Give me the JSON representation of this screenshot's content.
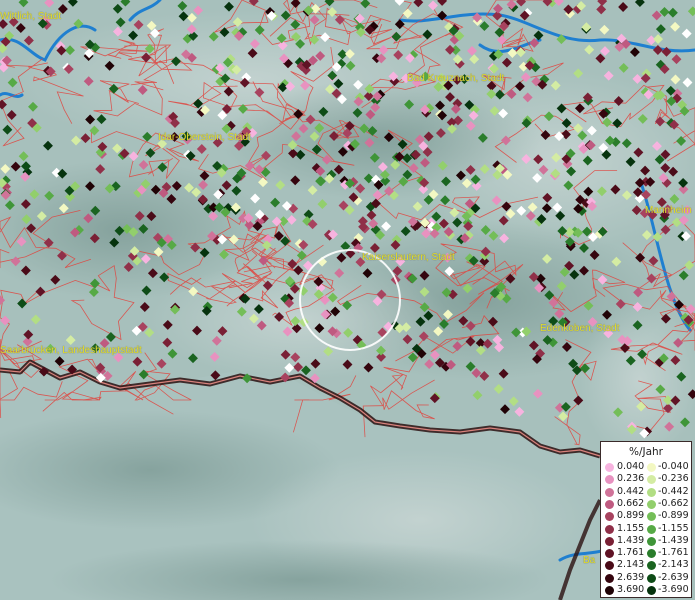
{
  "map": {
    "cities": [
      "Wittlich, Stadt",
      "Bad Kreuznach, Stadt",
      "Idar-Oberstein, Stadt",
      "Kaiserslautern, Stadt",
      "Mannheim",
      "Saarbrücken, Landeshauptstadt",
      "Edenkoben, Stadt",
      "Ba"
    ],
    "colors": {
      "terrain": "#9fb9b5",
      "borders_admin": "#e0453f",
      "border_state": "#2a1010",
      "rivers": "#1f7fd0",
      "search_circle": "#ffffff"
    }
  },
  "legend": {
    "title": "%/Jahr",
    "positive_values": [
      "0.040",
      "0.236",
      "0.442",
      "0.662",
      "0.899",
      "1.155",
      "1.439",
      "1.761",
      "2.143",
      "2.639",
      "3.690"
    ],
    "negative_values": [
      "-0.040",
      "-0.236",
      "-0.442",
      "-0.662",
      "-0.899",
      "-1.155",
      "-1.439",
      "-1.761",
      "-2.143",
      "-2.639",
      "-3.690"
    ],
    "positive_colors": [
      "#f7b3df",
      "#e892c0",
      "#d07399",
      "#bf5a80",
      "#a8435f",
      "#903049",
      "#7a2035",
      "#601325",
      "#4a0b18",
      "#35050e",
      "#200306"
    ],
    "negative_colors": [
      "#f3f8c2",
      "#d4eca3",
      "#b2de84",
      "#92cf6c",
      "#74be58",
      "#57aa46",
      "#3f9538",
      "#2a7d2b",
      "#1a6420",
      "#0e4c17",
      "#06330e"
    ]
  }
}
